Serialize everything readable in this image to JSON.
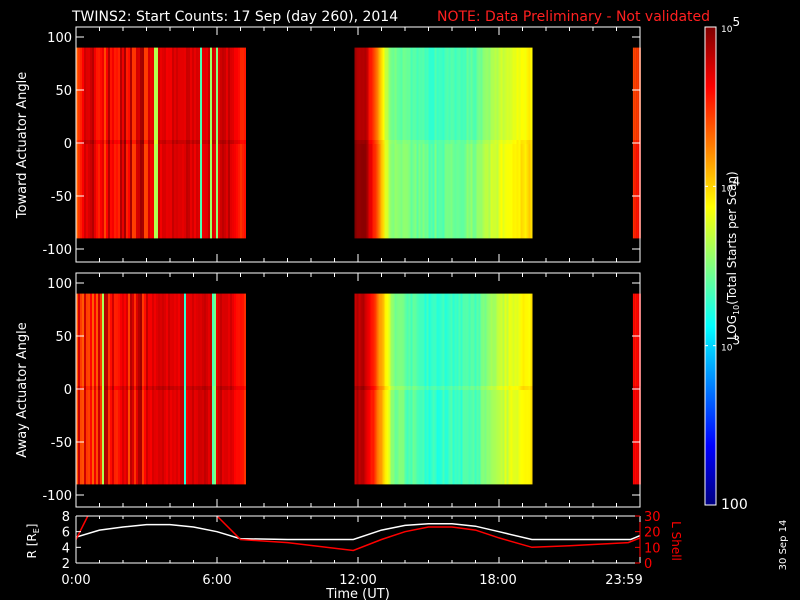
{
  "chart_data": {
    "type": "heatmap",
    "title": "TWINS2: Start Counts: 17 Sep (day 260), 2014",
    "note": "NOTE: Data Preliminary - Not validated",
    "xlabel": "Time (UT)",
    "xticks": [
      "0:00",
      "6:00",
      "12:00",
      "18:00",
      "23:59"
    ],
    "xlim_hours": [
      0,
      24
    ],
    "panels": [
      {
        "ylabel": "Toward Actuator Angle",
        "yticks": [
          "100",
          "50",
          "0",
          "-50",
          "-100"
        ],
        "ylim": [
          -100,
          100
        ],
        "angle_range": [
          -90,
          90
        ],
        "log_counts_profile": [
          {
            "start": 0,
            "end": 7.2,
            "points": [
              [
                0,
                4.6
              ],
              [
                3,
                4.7
              ],
              [
                6.5,
                4.75
              ],
              [
                7.2,
                4.5
              ]
            ]
          },
          {
            "start": 11.85,
            "end": 19.4,
            "points": [
              [
                11.85,
                4.85
              ],
              [
                12.3,
                4.8
              ],
              [
                12.8,
                4.2
              ],
              [
                13.3,
                3.5
              ],
              [
                15,
                3.3
              ],
              [
                17,
                3.4
              ],
              [
                18,
                3.7
              ],
              [
                19.4,
                3.95
              ]
            ]
          },
          {
            "start": 23.7,
            "end": 24,
            "points": [
              [
                23.7,
                4.45
              ],
              [
                24,
                4.45
              ]
            ]
          }
        ]
      },
      {
        "ylabel": "Away Actuator Angle",
        "yticks": [
          "100",
          "50",
          "0",
          "-50",
          "-100"
        ],
        "ylim": [
          -100,
          100
        ],
        "angle_range": [
          -90,
          90
        ],
        "log_counts_profile": [
          {
            "start": 0,
            "end": 7.2,
            "points": [
              [
                0,
                4.55
              ],
              [
                3,
                4.7
              ],
              [
                6.5,
                4.75
              ],
              [
                7.2,
                4.5
              ]
            ]
          },
          {
            "start": 11.85,
            "end": 19.4,
            "points": [
              [
                11.85,
                4.85
              ],
              [
                12.3,
                4.8
              ],
              [
                12.8,
                4.3
              ],
              [
                13.5,
                3.5
              ],
              [
                15,
                3.25
              ],
              [
                17,
                3.35
              ],
              [
                18,
                3.7
              ],
              [
                19.4,
                3.95
              ]
            ]
          },
          {
            "start": 23.7,
            "end": 24,
            "points": [
              [
                23.7,
                4.6
              ],
              [
                24,
                4.6
              ]
            ]
          }
        ]
      }
    ],
    "colorbar": {
      "label": "LOG10(Total Starts per Scan)",
      "label_main": "LOG",
      "label_sub": "10",
      "label_rest": "(Total Starts per Scan)",
      "ticks": [
        {
          "base": "10",
          "exp": "5",
          "log": 5
        },
        {
          "base": "10",
          "exp": "4",
          "log": 4
        },
        {
          "base": "10",
          "exp": "3",
          "log": 3
        },
        {
          "base": "100",
          "exp": "",
          "log": 2
        }
      ],
      "range_log": [
        2,
        5
      ]
    },
    "orbit": {
      "ylabel_left": "R [R",
      "ylabel_left_sub": "E",
      "ylabel_left_end": "]",
      "ylabel_right": "L Shell",
      "left_ticks": [
        "8",
        "6",
        "4",
        "2"
      ],
      "right_ticks": [
        "30",
        "20",
        "10",
        "0"
      ],
      "R_lim": [
        2,
        8
      ],
      "L_lim": [
        0,
        30
      ],
      "R": {
        "hours": [
          0,
          1,
          2,
          3,
          4,
          5,
          6,
          7,
          9,
          11.8,
          13,
          14,
          15,
          16,
          17,
          18,
          19.4,
          21,
          23.6,
          24
        ],
        "values": [
          5.3,
          6.2,
          6.6,
          6.9,
          6.9,
          6.6,
          6.0,
          5.1,
          5.0,
          5.0,
          6.2,
          6.8,
          7.0,
          7.0,
          6.7,
          6.0,
          5.0,
          5.0,
          5.0,
          5.5
        ]
      },
      "L_segments": [
        {
          "hours": [
            0,
            0.5
          ],
          "values": [
            15,
            30
          ]
        },
        {
          "hours": [
            6.0,
            7.0,
            9,
            11.8,
            13,
            14,
            15,
            16,
            17,
            18,
            19.4,
            21,
            23.5,
            24
          ],
          "values": [
            30,
            15,
            13,
            8,
            15,
            20,
            23,
            23,
            21,
            16,
            10,
            11,
            13,
            16
          ]
        }
      ],
      "R_color": "#ffffff",
      "L_color": "#ff0000"
    },
    "date_stamp": "30 Sep 14"
  }
}
